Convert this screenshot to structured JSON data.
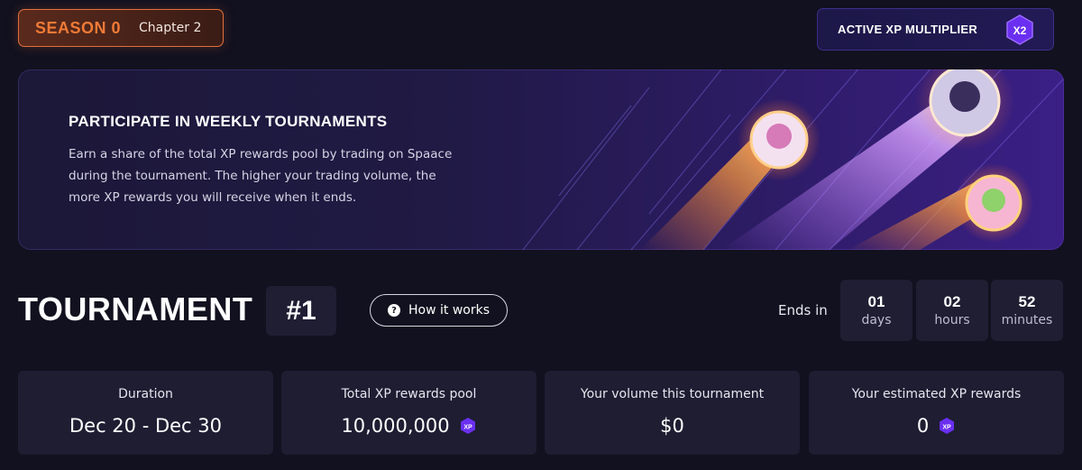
{
  "season": {
    "title": "SEASON 0",
    "chapter": "Chapter 2"
  },
  "multiplier": {
    "label": "ACTIVE XP MULTIPLIER",
    "badge": "X2"
  },
  "banner": {
    "title": "PARTICIPATE IN WEEKLY TOURNAMENTS",
    "description": "Earn a share of the total XP rewards pool by trading on Spaace during the tournament. The higher your trading volume, the more XP rewards you will receive when it ends."
  },
  "tournament": {
    "title": "TOURNAMENT",
    "number": "#1",
    "how_it_works": "How it works"
  },
  "countdown": {
    "label": "Ends in",
    "items": [
      {
        "value": "01",
        "unit": "days"
      },
      {
        "value": "02",
        "unit": "hours"
      },
      {
        "value": "52",
        "unit": "minutes"
      }
    ]
  },
  "stats": [
    {
      "label": "Duration",
      "value": "Dec 20 - Dec 30"
    },
    {
      "label": "Total XP rewards pool",
      "value": "10,000,000"
    },
    {
      "label": "Your volume this tournament",
      "value": "$0"
    },
    {
      "label": "Your estimated XP rewards",
      "value": "0"
    }
  ],
  "icons": {
    "xp_badge": "xp-hexagon-icon",
    "help": "question-icon"
  },
  "colors": {
    "accent_orange": "#f07a36",
    "accent_purple": "#6a2ff0",
    "background": "#12111f"
  },
  "xp_badge_text": "XP"
}
